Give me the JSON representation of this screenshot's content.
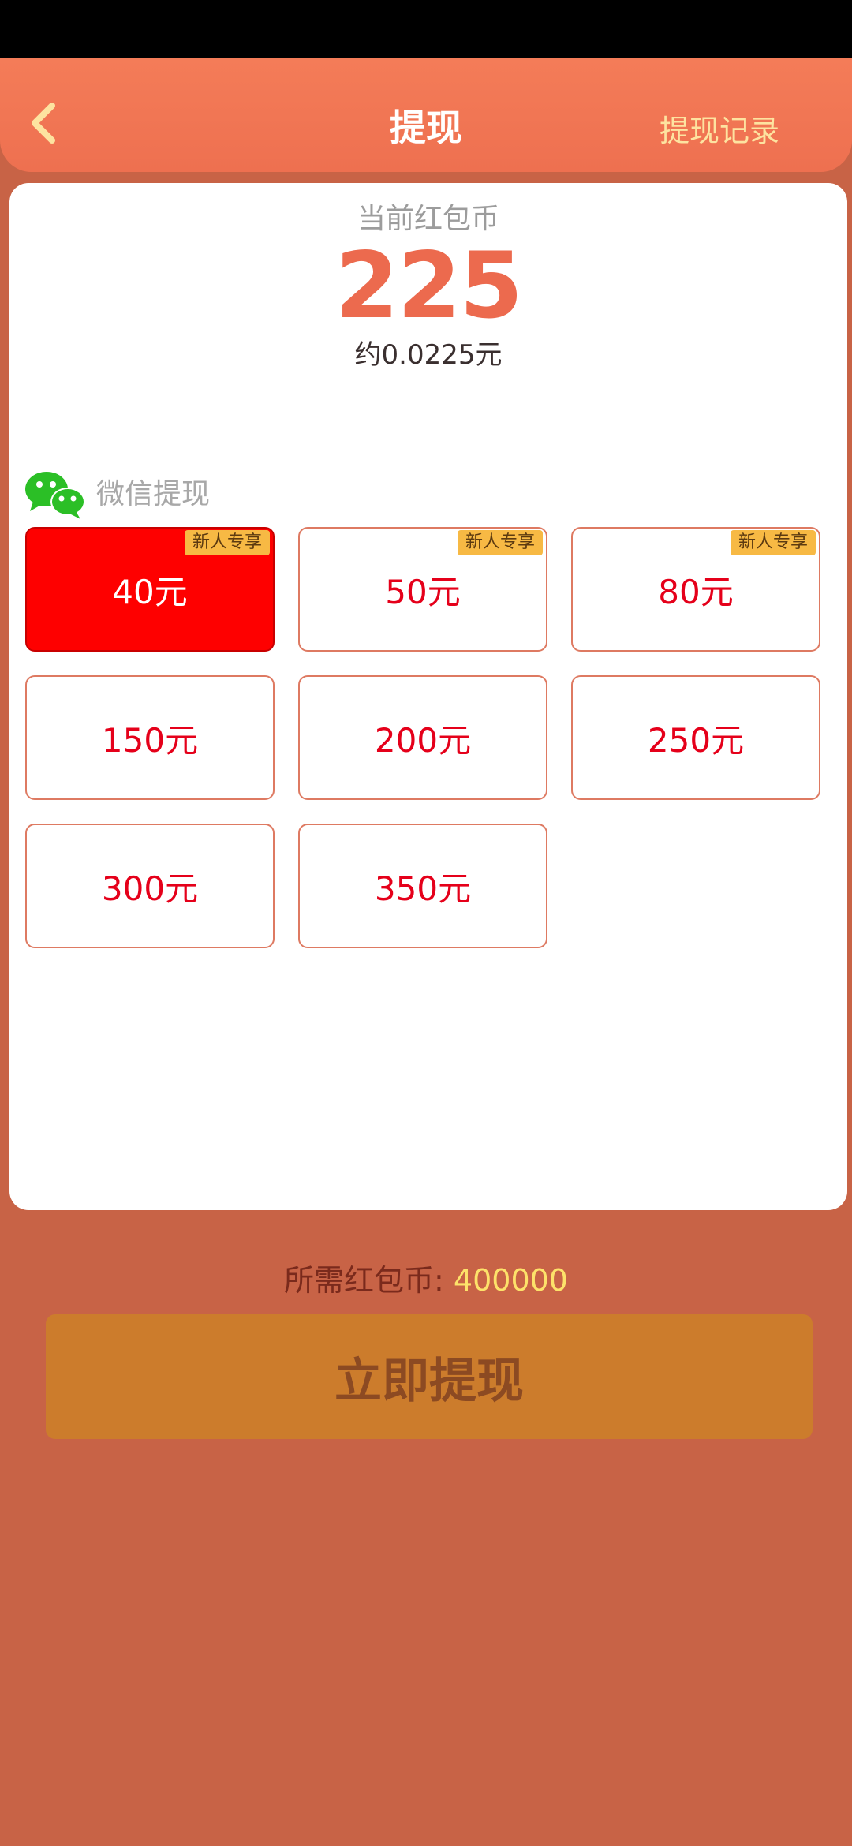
{
  "header": {
    "title": "提现",
    "record_link": "提现记录"
  },
  "balance": {
    "label": "当前红包币",
    "value": "225",
    "approx": "约0.0225元"
  },
  "method": {
    "label": "微信提现",
    "icon": "wechat-icon"
  },
  "options": [
    {
      "label": "40元",
      "badge": "新人专享",
      "selected": true
    },
    {
      "label": "50元",
      "badge": "新人专享",
      "selected": false
    },
    {
      "label": "80元",
      "badge": "新人专享",
      "selected": false
    },
    {
      "label": "150元",
      "selected": false
    },
    {
      "label": "200元",
      "selected": false
    },
    {
      "label": "250元",
      "selected": false
    },
    {
      "label": "300元",
      "selected": false
    },
    {
      "label": "350元",
      "selected": false
    }
  ],
  "required": {
    "label": "所需红包币:",
    "value": "400000"
  },
  "action": {
    "withdraw_label": "立即提现"
  },
  "colors": {
    "accent": "#ec6a4e",
    "selected_bg": "#fe0000",
    "badge_bg": "#f7b944",
    "page_bg": "#c86346"
  }
}
